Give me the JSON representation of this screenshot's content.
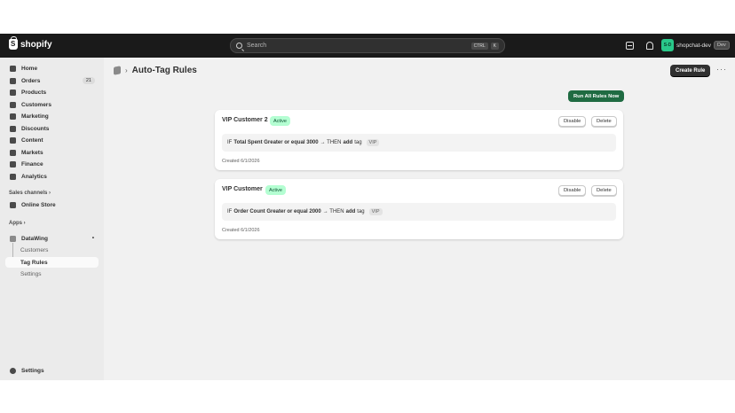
{
  "topbar": {
    "logo_text": "shopify",
    "search_placeholder": "Search",
    "shortcut_keys": [
      "CTRL",
      "K"
    ],
    "store_avatar_text": "S-D",
    "store_name": "shopchat-dev",
    "store_badge": "Dev"
  },
  "sidebar": {
    "items": [
      {
        "label": "Home"
      },
      {
        "label": "Orders",
        "count": "21"
      },
      {
        "label": "Products"
      },
      {
        "label": "Customers"
      },
      {
        "label": "Marketing"
      },
      {
        "label": "Discounts"
      },
      {
        "label": "Content"
      },
      {
        "label": "Markets"
      },
      {
        "label": "Finance"
      },
      {
        "label": "Analytics"
      }
    ],
    "sales_channels_label": "Sales channels",
    "online_store_label": "Online Store",
    "apps_label": "Apps",
    "app_name": "DataWing",
    "app_subitems": [
      {
        "label": "Customers"
      },
      {
        "label": "Tag Rules"
      },
      {
        "label": "Settings"
      }
    ],
    "settings_label": "Settings"
  },
  "page": {
    "title": "Auto-Tag Rules",
    "create_button": "Create Rule",
    "run_all_button": "Run All Rules Now"
  },
  "rules": [
    {
      "name": "VIP Customer 2",
      "status": "Active",
      "if_label": "IF",
      "condition": "Total Spent Greater or equal 3000",
      "arrow_then": "→ THEN",
      "action": "add",
      "tag_word": "tag",
      "tag_value": "VIP",
      "created": "Created 6/1/2026",
      "disable_label": "Disable",
      "delete_label": "Delete"
    },
    {
      "name": "VIP Customer",
      "status": "Active",
      "if_label": "IF",
      "condition": "Order Count Greater or equal 2000",
      "arrow_then": "→ THEN",
      "action": "add",
      "tag_word": "tag",
      "tag_value": "VIP",
      "created": "Created 6/1/2026",
      "disable_label": "Disable",
      "delete_label": "Delete"
    }
  ]
}
